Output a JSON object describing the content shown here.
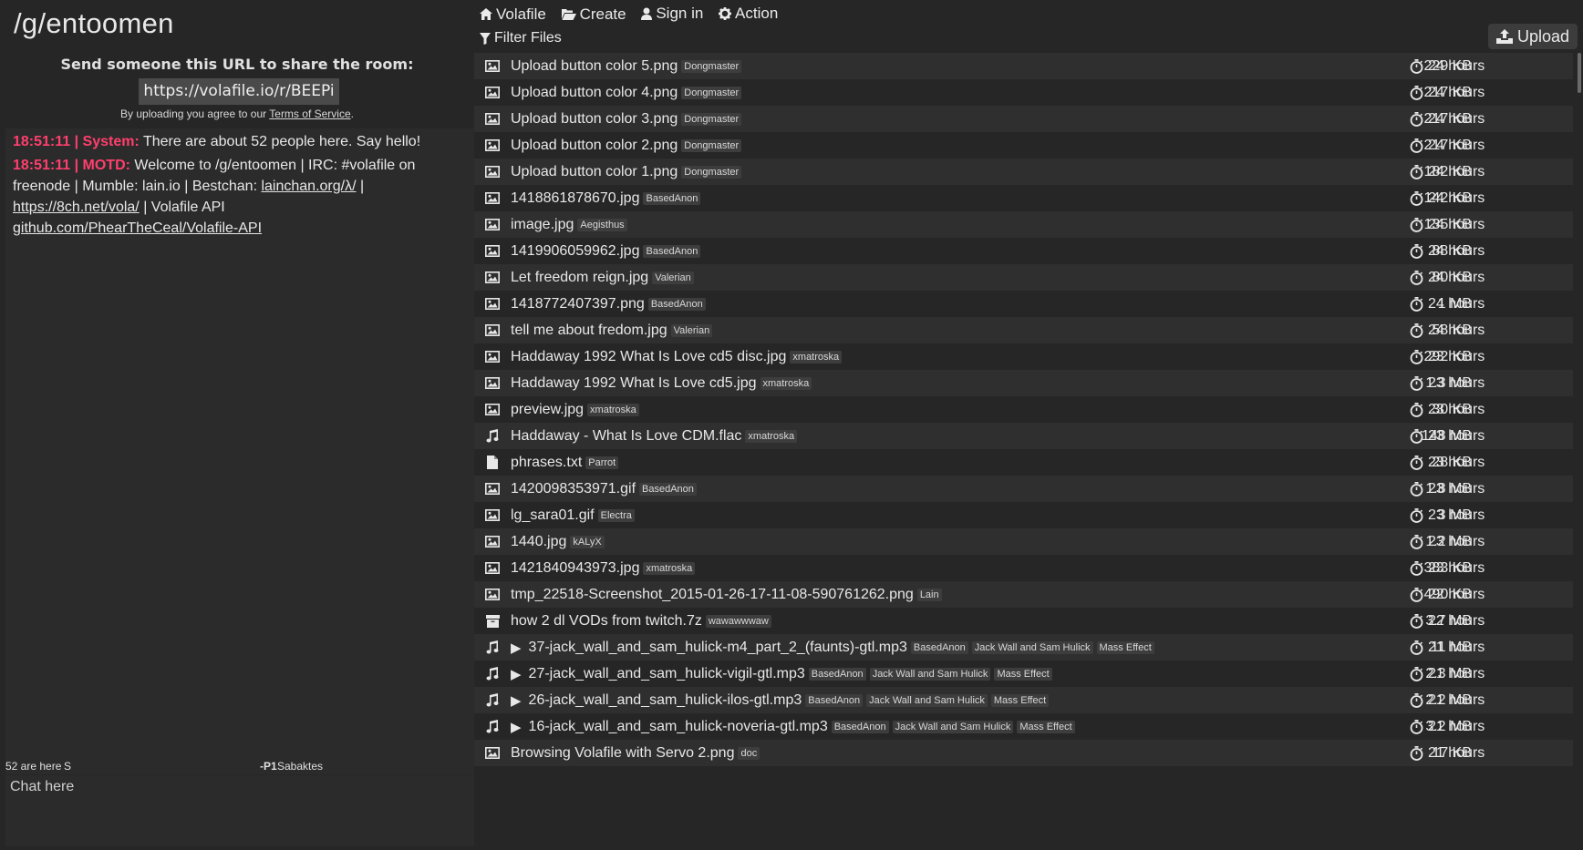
{
  "room": {
    "title": "/g/entoomen",
    "share_text": "Send someone this URL to share the room:",
    "share_url": "https://volafile.io/r/BEEPi",
    "tos_prefix": "By uploading you agree to our ",
    "tos_link": "Terms of Service",
    "tos_suffix": "."
  },
  "chat": {
    "messages": [
      {
        "meta": "18:51:11 | System:",
        "text": "There are about 52 people here. Say hello!"
      },
      {
        "meta": "18:51:11 | MOTD:",
        "text_a": "Welcome to /g/entoomen | IRC: #volafile on freenode | Mumble: lain.io | Bestchan: ",
        "link1": "lainchan.org/λ/",
        "text_b": " | ",
        "link2": "https://8ch.net/vola/",
        "text_c": " | Volafile API ",
        "link3": "github.com/PhearTheCeal/Volafile-API"
      }
    ],
    "status": {
      "count": "52 are here",
      "s": "S",
      "p1": "-P1",
      "user": "Sabaktes"
    },
    "input_placeholder": "Chat here"
  },
  "nav": {
    "volafile": "Volafile",
    "create": "Create",
    "signin": "Sign in",
    "action": "Action",
    "filter": "Filter Files",
    "upload": "Upload"
  },
  "files": [
    {
      "type": "image",
      "name": "Upload button color 5.png",
      "tags": [
        "Dongmaster"
      ],
      "size": "229 KB",
      "ttl": "24 hours"
    },
    {
      "type": "image",
      "name": "Upload button color 4.png",
      "tags": [
        "Dongmaster"
      ],
      "size": "217 KB",
      "ttl": "24 hours"
    },
    {
      "type": "image",
      "name": "Upload button color 3.png",
      "tags": [
        "Dongmaster"
      ],
      "size": "217 KB",
      "ttl": "24 hours"
    },
    {
      "type": "image",
      "name": "Upload button color 2.png",
      "tags": [
        "Dongmaster"
      ],
      "size": "217 KB",
      "ttl": "24 hours"
    },
    {
      "type": "image",
      "name": "Upload button color 1.png",
      "tags": [
        "Dongmaster"
      ],
      "size": "182 KB",
      "ttl": "24 hours"
    },
    {
      "type": "image",
      "name": "1418861878670.jpg",
      "tags": [
        "BasedAnon"
      ],
      "size": "142 KB",
      "ttl": "24 hours"
    },
    {
      "type": "image",
      "name": "image.jpg",
      "tags": [
        "Aegisthus"
      ],
      "size": "135 KB",
      "ttl": "24 hours"
    },
    {
      "type": "image",
      "name": "1419906059962.jpg",
      "tags": [
        "BasedAnon"
      ],
      "size": "88 KB",
      "ttl": "24 hours"
    },
    {
      "type": "image",
      "name": "Let freedom reign.jpg",
      "tags": [
        "Valerian"
      ],
      "size": "80 KB",
      "ttl": "24 hours"
    },
    {
      "type": "image",
      "name": "1418772407397.png",
      "tags": [
        "BasedAnon"
      ],
      "size": "1 MB",
      "ttl": "24 hours"
    },
    {
      "type": "image",
      "name": "tell me about fredom.jpg",
      "tags": [
        "Valerian"
      ],
      "size": "58 KB",
      "ttl": "24 hours"
    },
    {
      "type": "image",
      "name": "Haddaway 1992 What Is Love cd5 disc.jpg",
      "tags": [
        "xmatroska"
      ],
      "size": "292 KB",
      "ttl": "23 hours"
    },
    {
      "type": "image",
      "name": "Haddaway 1992 What Is Love cd5.jpg",
      "tags": [
        "xmatroska"
      ],
      "size": "1.3 MB",
      "ttl": "23 hours"
    },
    {
      "type": "image",
      "name": "preview.jpg",
      "tags": [
        "xmatroska"
      ],
      "size": "30 KB",
      "ttl": "23 hours"
    },
    {
      "type": "audio",
      "name": "Haddaway - What Is Love CDM.flac",
      "tags": [
        "xmatroska"
      ],
      "size": "148 MB",
      "ttl": "23 hours"
    },
    {
      "type": "document",
      "name": "phrases.txt",
      "tags": [
        "Parrot"
      ],
      "size": "28 KB",
      "ttl": "23 hours"
    },
    {
      "type": "image",
      "name": "1420098353971.gif",
      "tags": [
        "BasedAnon"
      ],
      "size": "1.8 MB",
      "ttl": "23 hours"
    },
    {
      "type": "image",
      "name": "lg_sara01.gif",
      "tags": [
        "Electra"
      ],
      "size": "3 MB",
      "ttl": "23 hours"
    },
    {
      "type": "image",
      "name": "1440.jpg",
      "tags": [
        "kALyX"
      ],
      "size": "1.2 MB",
      "ttl": "23 hours"
    },
    {
      "type": "image",
      "name": "1421840943973.jpg",
      "tags": [
        "xmatroska"
      ],
      "size": "383 KB",
      "ttl": "23 hours"
    },
    {
      "type": "image",
      "name": "tmp_22518-Screenshot_2015-01-26-17-11-08-590761262.png",
      "tags": [
        "Lain"
      ],
      "size": "490 KB",
      "ttl": "22 hours"
    },
    {
      "type": "archive",
      "name": "how 2 dl VODs from twitch.7z",
      "tags": [
        "wawawwwaw"
      ],
      "size": "3.7 MB",
      "ttl": "22 hours"
    },
    {
      "type": "audio",
      "play": "▶",
      "name": "37-jack_wall_and_sam_hulick-m4_part_2_(faunts)-gtl.mp3",
      "tags": [
        "BasedAnon",
        "Jack Wall and Sam Hulick",
        "Mass Effect"
      ],
      "size": "11 MB",
      "ttl": "21 hours"
    },
    {
      "type": "audio",
      "play": "▶",
      "name": "27-jack_wall_and_sam_hulick-vigil-gtl.mp3",
      "tags": [
        "BasedAnon",
        "Jack Wall and Sam Hulick",
        "Mass Effect"
      ],
      "size": "2.3 MB",
      "ttl": "21 hours"
    },
    {
      "type": "audio",
      "play": "▶",
      "name": "26-jack_wall_and_sam_hulick-ilos-gtl.mp3",
      "tags": [
        "BasedAnon",
        "Jack Wall and Sam Hulick",
        "Mass Effect"
      ],
      "size": "2.2 MB",
      "ttl": "21 hours"
    },
    {
      "type": "audio",
      "play": "▶",
      "name": "16-jack_wall_and_sam_hulick-noveria-gtl.mp3",
      "tags": [
        "BasedAnon",
        "Jack Wall and Sam Hulick",
        "Mass Effect"
      ],
      "size": "3.2 MB",
      "ttl": "21 hours"
    },
    {
      "type": "image",
      "name": "Browsing Volafile with Servo 2.png",
      "tags": [
        "doc"
      ],
      "size": "17 KB",
      "ttl": "21 hours"
    }
  ],
  "colors": {
    "accent": "#ff3f6d",
    "background": "#262626",
    "row_alt": "#2f2f2f",
    "tag_bg": "#3d3d3d"
  }
}
